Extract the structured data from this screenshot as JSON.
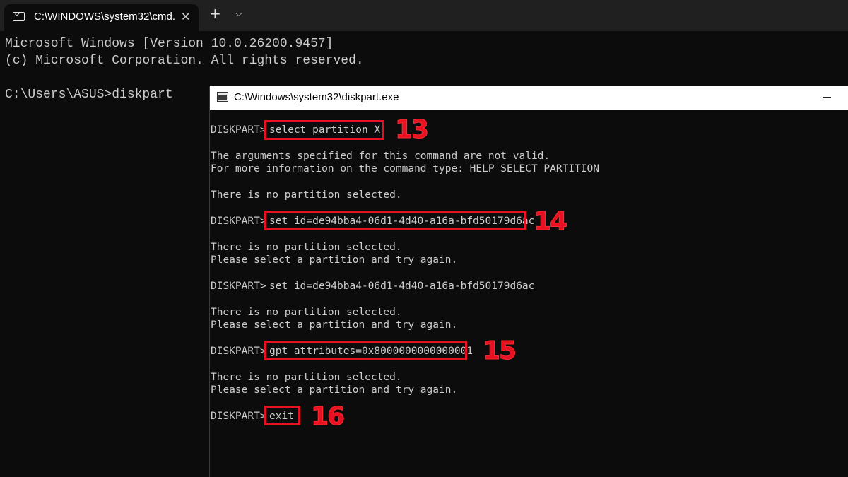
{
  "terminal": {
    "tab": {
      "title": "C:\\WINDOWS\\system32\\cmd.",
      "close": "✕"
    },
    "new_tab": "+",
    "dropdown": "⌵"
  },
  "cmd": {
    "lines": [
      "Microsoft Windows [Version 10.0.26200.9457]",
      "(c) Microsoft Corporation. All rights reserved.",
      "",
      "C:\\Users\\ASUS>diskpart"
    ]
  },
  "diskpart": {
    "title": "C:\\Windows\\system32\\diskpart.exe",
    "prompt": "DISKPART>",
    "lines": [
      "select partition X",
      "The arguments specified for this command are not valid.",
      "For more information on the command type: HELP SELECT PARTITION",
      "There is no partition selected.",
      "set id=de94bba4-06d1-4d40-a16a-bfd50179d6ac",
      "There is no partition selected.",
      "Please select a partition and try again.",
      "set id=de94bba4-06d1-4d40-a16a-bfd50179d6ac",
      "There is no partition selected.",
      "Please select a partition and try again.",
      "gpt attributes=0x8000000000000001",
      "There is no partition selected.",
      "Please select a partition and try again.",
      "exit"
    ],
    "annotations": [
      "13",
      "14",
      "15",
      "16"
    ]
  }
}
